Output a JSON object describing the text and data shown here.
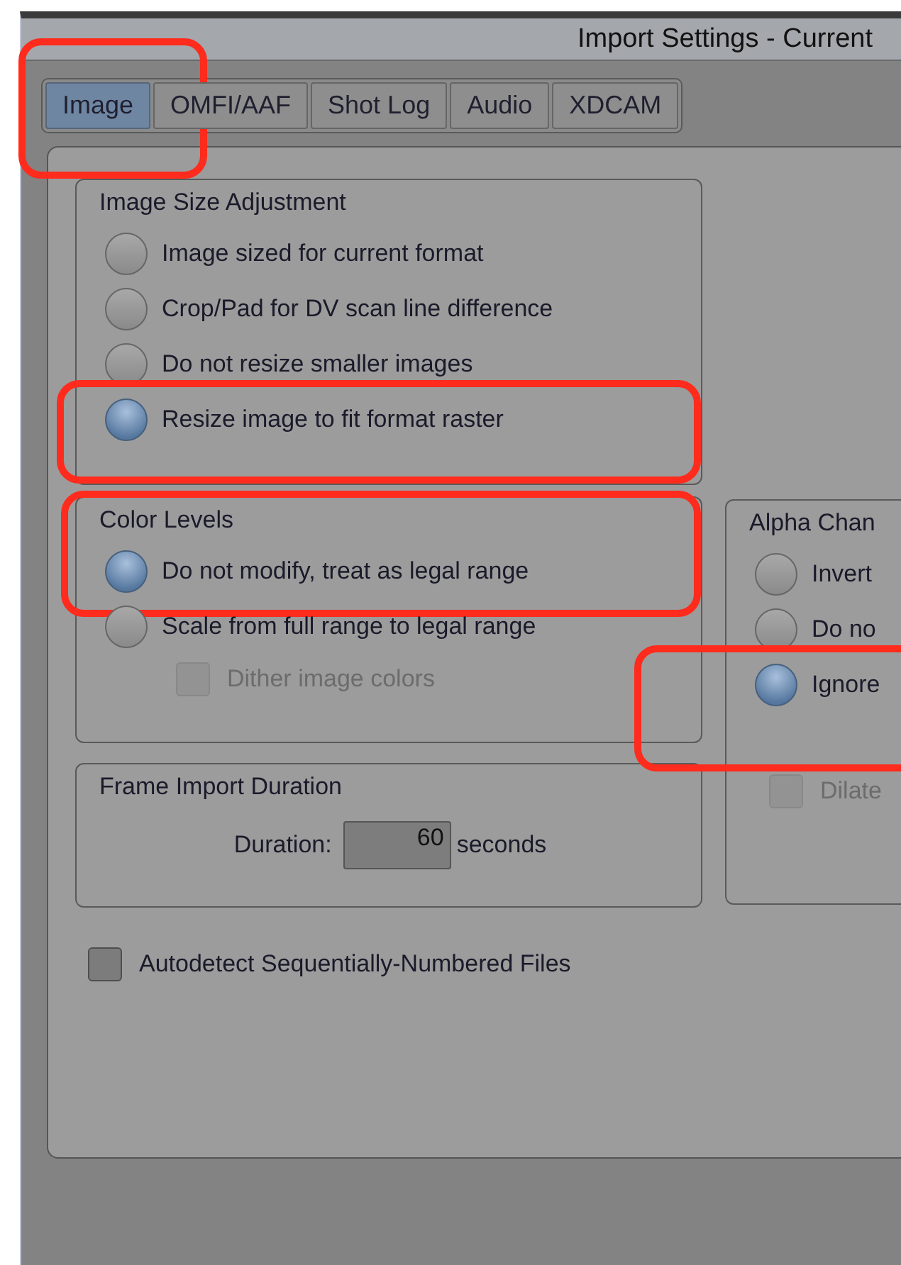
{
  "window": {
    "title": "Import Settings - Current"
  },
  "tabs": [
    {
      "label": "Image",
      "selected": true,
      "highlighted": true
    },
    {
      "label": "OMFI/AAF",
      "selected": false
    },
    {
      "label": "Shot Log",
      "selected": false
    },
    {
      "label": "Audio",
      "selected": false
    },
    {
      "label": "XDCAM",
      "selected": false
    }
  ],
  "groups": [
    {
      "title": "Image Size Adjustment",
      "items": [
        {
          "kind": "radio",
          "label": "Image sized for current format",
          "selected": false
        },
        {
          "kind": "radio",
          "label": "Crop/Pad for DV scan line difference",
          "selected": false
        },
        {
          "kind": "radio",
          "label": "Do not resize smaller images",
          "selected": false
        },
        {
          "kind": "radio",
          "label": "Resize image to fit format raster",
          "selected": true,
          "highlighted": true
        }
      ]
    },
    {
      "title": "Color Levels",
      "highlighted": true,
      "items": [
        {
          "kind": "radio",
          "label": "Do not modify, treat as legal range",
          "selected": true
        },
        {
          "kind": "radio",
          "label": "Scale from full range to legal range",
          "selected": false
        },
        {
          "kind": "checkbox",
          "label": "Dither image colors",
          "checked": false,
          "disabled": true
        }
      ]
    },
    {
      "title": "Alpha Chan",
      "items": [
        {
          "kind": "radio",
          "label": "Invert",
          "selected": false
        },
        {
          "kind": "radio",
          "label": "Do no",
          "selected": false
        },
        {
          "kind": "radio",
          "label": "Ignore",
          "selected": true,
          "highlighted": true
        },
        {
          "kind": "checkbox",
          "label": "Dilate",
          "checked": false,
          "disabled": true
        }
      ]
    },
    {
      "title": "Frame Import Duration",
      "items": [
        {
          "kind": "field",
          "label": "Duration:",
          "value": "60",
          "unit": "seconds"
        }
      ]
    }
  ],
  "checkboxes": [
    {
      "label": "Autodetect Sequentially-Numbered Files",
      "checked": false,
      "disabled": false
    }
  ]
}
